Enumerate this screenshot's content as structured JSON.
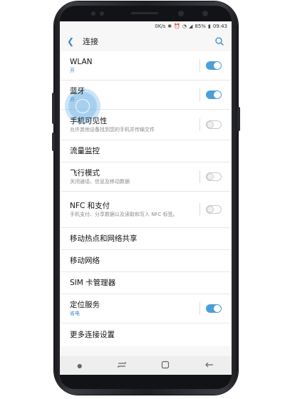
{
  "status_bar": {
    "net_speed": "0K/s",
    "battery": "85%",
    "time": "09:43"
  },
  "header": {
    "title": "连接"
  },
  "settings": [
    {
      "title": "WLAN",
      "subtitle": "开",
      "toggle": "on"
    },
    {
      "title": "蓝牙",
      "subtitle": "开",
      "toggle": "on"
    },
    {
      "title": "手机可见性",
      "subtitle": "允许其他设备找到您的手机并传输文件",
      "toggle": "off"
    },
    {
      "title": "流量监控",
      "subtitle": "",
      "toggle": "none"
    },
    {
      "title": "飞行模式",
      "subtitle": "关闭通话、信息及移动数据",
      "toggle": "off"
    },
    {
      "title": "NFC 和支付",
      "subtitle": "手机支付、分享数据以及读取和写入 NFC 标签。",
      "toggle": "off"
    },
    {
      "title": "移动热点和网络共享",
      "subtitle": "",
      "toggle": "none"
    },
    {
      "title": "移动网络",
      "subtitle": "",
      "toggle": "none"
    },
    {
      "title": "SIM 卡管理器",
      "subtitle": "",
      "toggle": "none"
    },
    {
      "title": "定位服务",
      "subtitle": "省电",
      "toggle": "on"
    },
    {
      "title": "更多连接设置",
      "subtitle": "",
      "toggle": "none"
    }
  ],
  "colors": {
    "accent": "#3a87c8",
    "toggle_on": "#4c9fd8"
  }
}
